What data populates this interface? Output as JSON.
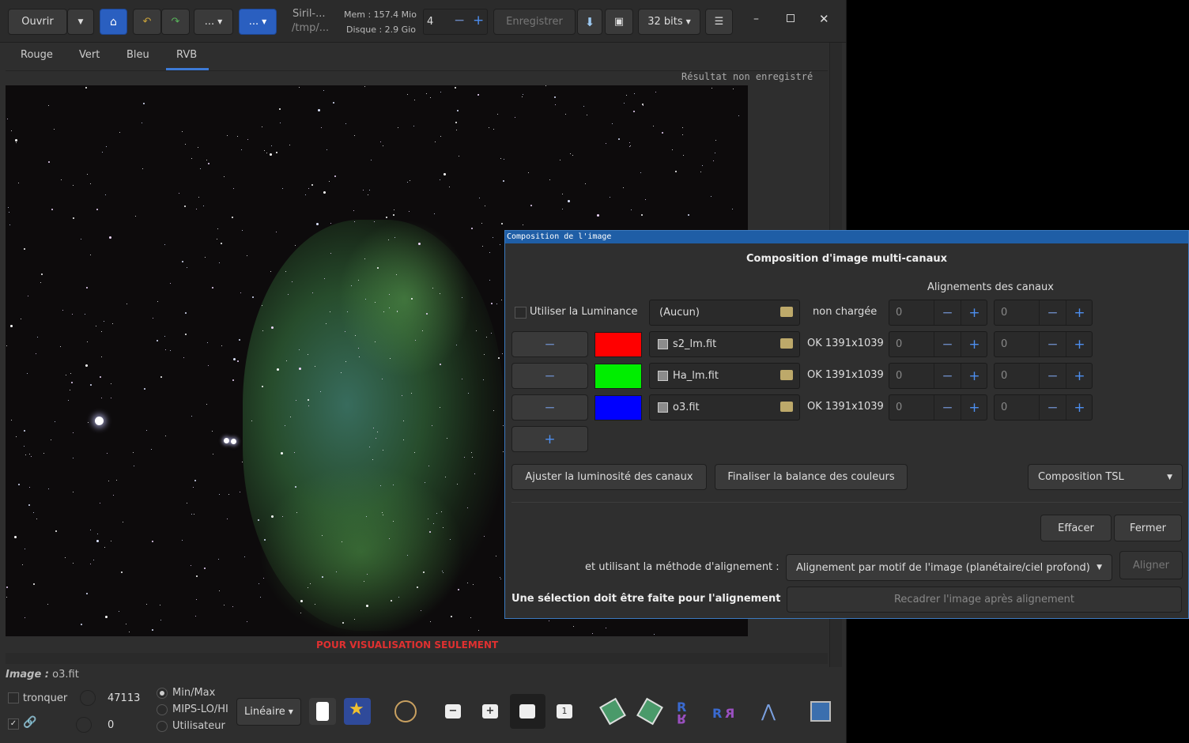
{
  "toolbar": {
    "open_label": "Ouvrir",
    "more1_label": "...",
    "more2_label": "...",
    "title_line1": "Siril-...",
    "title_line2": "/tmp/...",
    "mem": "Mem : 157.4 Mio",
    "disk": "Disque : 2.9 Gio",
    "threads_value": "4",
    "save_label": "Enregistrer",
    "bitdepth": "32 bits"
  },
  "tabs": [
    "Rouge",
    "Vert",
    "Bleu",
    "RVB"
  ],
  "status": {
    "unsaved": "Résultat non enregistré",
    "preview_warning": "POUR VISUALISATION SEULEMENT",
    "image_label": "Image :",
    "image_name": "o3.fit"
  },
  "bottom": {
    "clip_label": "tronquer",
    "high_value": "47113",
    "low_value": "0",
    "radio_minmax": "Min/Max",
    "radio_mips": "MIPS-LO/HI",
    "radio_user": "Utilisateur",
    "stretch_mode": "Linéaire"
  },
  "dialog": {
    "window_title": "Composition de l'image",
    "heading": "Composition d'image multi-canaux",
    "align_header": "Alignements des canaux",
    "luminance_label": "Utiliser la Luminance",
    "luminance_file": "(Aucun)",
    "luminance_status": "non chargée",
    "rows": [
      {
        "color": "#ff0000",
        "file": "s2_lm.fit",
        "status": "OK 1391x1039",
        "x": "0",
        "y": "0"
      },
      {
        "color": "#00ee00",
        "file": "Ha_lm.fit",
        "status": "OK 1391x1039",
        "x": "0",
        "y": "0"
      },
      {
        "color": "#0000ff",
        "file": "o3.fit",
        "status": "OK 1391x1039",
        "x": "0",
        "y": "0"
      }
    ],
    "lum_x": "0",
    "lum_y": "0",
    "remove_symbol": "−",
    "add_symbol": "+",
    "btn_adjust": "Ajuster la luminosité des canaux",
    "btn_balance": "Finaliser la balance des couleurs",
    "composition_mode": "Composition TSL",
    "btn_clear": "Effacer",
    "btn_close": "Fermer",
    "align_method_label": "et utilisant la méthode d'alignement :",
    "align_method_value": "Alignement par motif de l'image (planétaire/ciel profond)",
    "btn_align": "Aligner",
    "selection_warning": "Une sélection doit être faite pour l'alignement",
    "recrop_label": "Recadrer l'image après alignement"
  }
}
